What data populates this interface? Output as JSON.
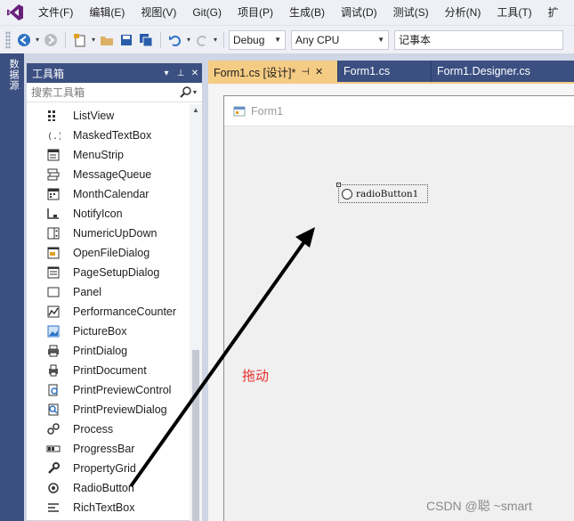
{
  "menubar": {
    "items": [
      "文件(F)",
      "编辑(E)",
      "视图(V)",
      "Git(G)",
      "项目(P)",
      "生成(B)",
      "调试(D)",
      "测试(S)",
      "分析(N)",
      "工具(T)",
      "扩"
    ]
  },
  "toolbar": {
    "config": "Debug",
    "platform": "Any CPU",
    "project": "记事本"
  },
  "left_tab": {
    "label": "数据源"
  },
  "toolbox": {
    "title": "工具箱",
    "search_placeholder": "搜索工具箱",
    "items": [
      {
        "label": "ListView",
        "icon": "listview-icon"
      },
      {
        "label": "MaskedTextBox",
        "icon": "maskedtextbox-icon"
      },
      {
        "label": "MenuStrip",
        "icon": "menustrip-icon"
      },
      {
        "label": "MessageQueue",
        "icon": "messagequeue-icon"
      },
      {
        "label": "MonthCalendar",
        "icon": "monthcalendar-icon"
      },
      {
        "label": "NotifyIcon",
        "icon": "notifyicon-icon"
      },
      {
        "label": "NumericUpDown",
        "icon": "numericupdown-icon"
      },
      {
        "label": "OpenFileDialog",
        "icon": "openfiledialog-icon"
      },
      {
        "label": "PageSetupDialog",
        "icon": "pagesetupdialog-icon"
      },
      {
        "label": "Panel",
        "icon": "panel-icon"
      },
      {
        "label": "PerformanceCounter",
        "icon": "performancecounter-icon"
      },
      {
        "label": "PictureBox",
        "icon": "picturebox-icon"
      },
      {
        "label": "PrintDialog",
        "icon": "printdialog-icon"
      },
      {
        "label": "PrintDocument",
        "icon": "printdocument-icon"
      },
      {
        "label": "PrintPreviewControl",
        "icon": "printpreviewcontrol-icon"
      },
      {
        "label": "PrintPreviewDialog",
        "icon": "printpreviewdialog-icon"
      },
      {
        "label": "Process",
        "icon": "process-icon"
      },
      {
        "label": "ProgressBar",
        "icon": "progressbar-icon"
      },
      {
        "label": "PropertyGrid",
        "icon": "propertygrid-icon"
      },
      {
        "label": "RadioButton",
        "icon": "radiobutton-icon"
      },
      {
        "label": "RichTextBox",
        "icon": "richtextbox-icon"
      }
    ]
  },
  "tabs": [
    {
      "label": "Form1.cs [设计]*",
      "active": true
    },
    {
      "label": "Form1.cs",
      "active": false
    },
    {
      "label": "Form1.Designer.cs",
      "active": false
    }
  ],
  "designer": {
    "form_title": "Form1",
    "radio_label": "radioButton1"
  },
  "annotation": {
    "drag_label": "拖动",
    "color": "#e62e2e"
  },
  "watermark": "CSDN @聪     ~smart",
  "colors": {
    "accent": "#3b4f81",
    "active_tab": "#f5cc84",
    "vs_purple": "#68217a"
  }
}
